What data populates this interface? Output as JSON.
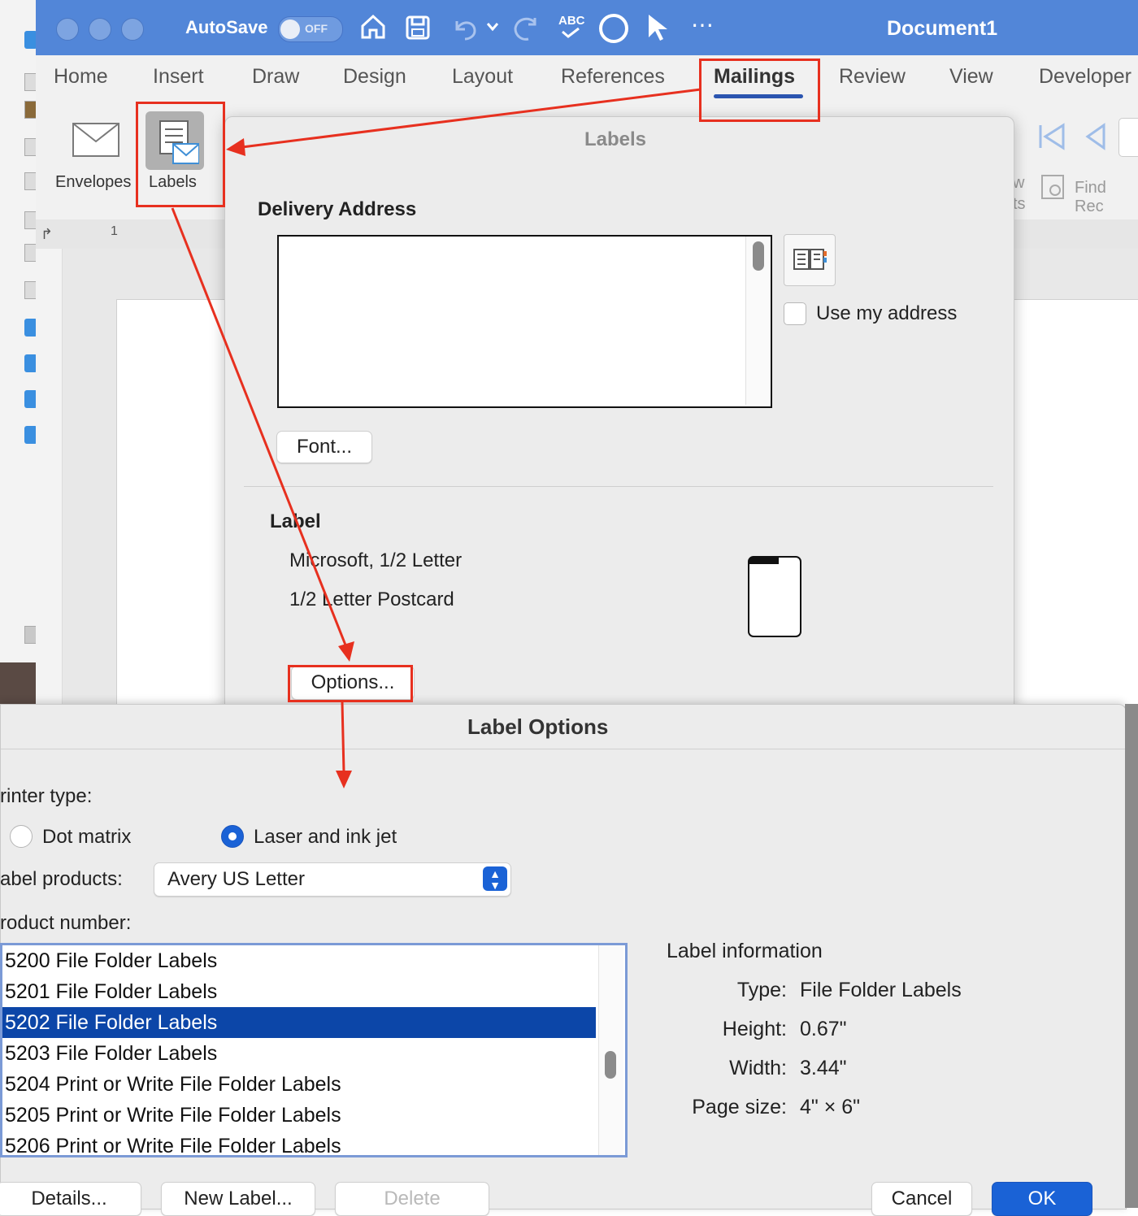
{
  "window": {
    "title": "Document1"
  },
  "titlebar": {
    "autosave_label": "AutoSave",
    "autosave_state": "OFF",
    "spelling_icon_text": "ABC"
  },
  "menu": {
    "tabs": [
      "Home",
      "Insert",
      "Draw",
      "Design",
      "Layout",
      "References",
      "Mailings",
      "Review",
      "View",
      "Developer"
    ],
    "active": "Mailings"
  },
  "ribbon": {
    "envelopes": "Envelopes",
    "labels": "Labels",
    "find_partial": "Find Rec",
    "partial_w": "w",
    "partial_ts": "ts"
  },
  "ruler": {
    "mark": "1"
  },
  "labels_dialog": {
    "title": "Labels",
    "delivery_heading": "Delivery Address",
    "use_my_address": "Use my address",
    "font_button": "Font...",
    "label_heading": "Label",
    "label_vendor": "Microsoft, 1/2 Letter",
    "label_product": "1/2 Letter Postcard",
    "options_button": "Options..."
  },
  "label_options": {
    "title": "Label Options",
    "printer_type_label": "rinter type:",
    "dot_matrix": "Dot matrix",
    "laser": "Laser and ink jet",
    "selected_printer": "Laser and ink jet",
    "label_products_label": "abel products:",
    "label_products_value": "Avery US Letter",
    "product_number_label": "roduct number:",
    "products": [
      "5200 File Folder Labels",
      "5201 File Folder Labels",
      "5202 File Folder Labels",
      "5203 File Folder Labels",
      "5204 Print or Write File Folder Labels",
      "5205 Print or Write File Folder Labels",
      "5206 Print or Write File Folder Labels"
    ],
    "selected_product": "5202 File Folder Labels",
    "info": {
      "heading": "Label information",
      "type_label": "Type:",
      "type_value": "File Folder Labels",
      "height_label": "Height:",
      "height_value": "0.67\"",
      "width_label": "Width:",
      "width_value": "3.44\"",
      "page_size_label": "Page size:",
      "page_size_value": "4\" × 6\""
    },
    "buttons": {
      "details": "Details...",
      "new_label": "New Label...",
      "delete": "Delete",
      "cancel": "Cancel",
      "ok": "OK"
    }
  },
  "colors": {
    "titlebar": "#5286d8",
    "accent": "#1a62d6",
    "annotation": "#e7301f",
    "selection": "#0c46a8"
  }
}
